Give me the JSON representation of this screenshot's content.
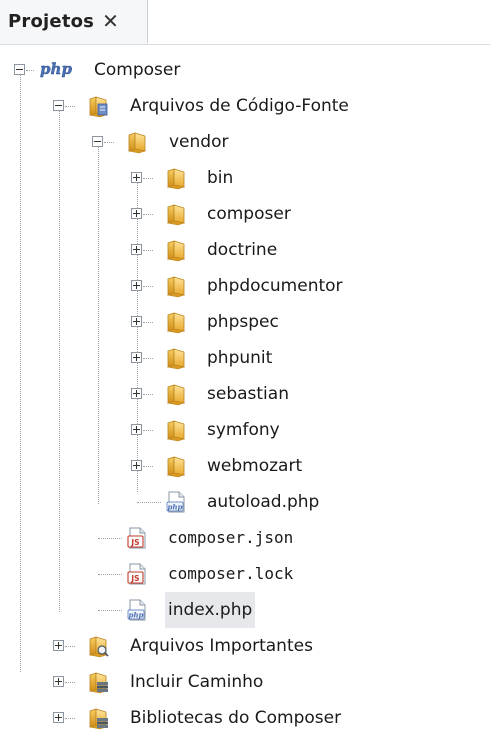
{
  "tab": {
    "label": "Projetos",
    "close": "✕"
  },
  "project": {
    "label": "Composer",
    "logo_text": "php"
  },
  "source_folder": {
    "label": "Arquivos de Código-Fonte"
  },
  "vendor": {
    "label": "vendor",
    "children": [
      "bin",
      "composer",
      "doctrine",
      "phpdocumentor",
      "phpspec",
      "phpunit",
      "sebastian",
      "symfony",
      "webmozart"
    ],
    "autoload": "autoload.php"
  },
  "files": {
    "composer_json": "composer.json",
    "composer_lock": "composer.lock",
    "index": "index.php"
  },
  "bottom_nodes": {
    "important": "Arquivos Importantes",
    "include_path": "Incluir Caminho",
    "libraries": "Bibliotecas do Composer"
  },
  "icon_labels": {
    "php": "php",
    "json": "JS"
  },
  "colors": {
    "selection": "#e6e8ec",
    "folder": "#f2c14e",
    "php_blue": "#4a6fb5",
    "json_red": "#c33a2a"
  }
}
